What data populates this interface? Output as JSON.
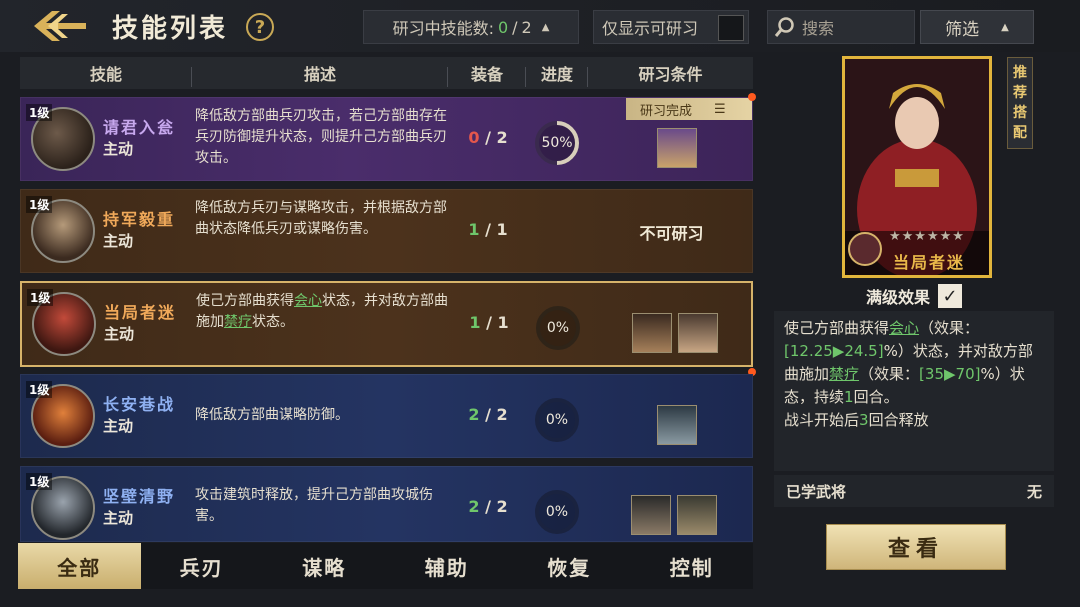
{
  "header": {
    "title": "技能列表",
    "help": "?",
    "research_label": "研习中技能数:",
    "research_current": "0",
    "research_sep": "/",
    "research_max": "2",
    "only_show_label": "仅显示可研习",
    "search_placeholder": "搜索",
    "filter_label": "筛选"
  },
  "columns": {
    "skill": "技能",
    "desc": "描述",
    "equip": "装备",
    "progress": "进度",
    "condition": "研习条件"
  },
  "skills": [
    {
      "level": "1级",
      "name": "请君入瓮",
      "type": "主动",
      "desc": "降低敌方部曲兵刃攻击，若己方部曲存在兵刃防御提升状态，则提升己方部曲兵刃攻击。",
      "equip_cur": "0",
      "equip_max": "2",
      "progress": "50%",
      "progress_value": 0.5,
      "badge": "研习完成"
    },
    {
      "level": "1级",
      "name": "持军毅重",
      "type": "主动",
      "desc": "降低敌方兵刃与谋略攻击，并根据敌方部曲状态降低兵刃或谋略伤害。",
      "equip_cur": "1",
      "equip_max": "1",
      "condition_text": "不可研习"
    },
    {
      "level": "1级",
      "name": "当局者迷",
      "type": "主动",
      "desc_pre": "使己方部曲获得",
      "desc_kw1": "会心",
      "desc_mid": "状态，并对敌方部曲施加",
      "desc_kw2": "禁疗",
      "desc_post": "状态。",
      "equip_cur": "1",
      "equip_max": "1",
      "progress": "0%",
      "progress_value": 0
    },
    {
      "level": "1级",
      "name": "长安巷战",
      "type": "主动",
      "desc": "降低敌方部曲谋略防御。",
      "equip_cur": "2",
      "equip_max": "2",
      "progress": "0%",
      "progress_value": 0
    },
    {
      "level": "1级",
      "name": "坚壁清野",
      "type": "主动",
      "desc": "攻击建筑时释放，提升己方部曲攻城伤害。",
      "equip_cur": "2",
      "equip_max": "2",
      "progress": "0%",
      "progress_value": 0
    }
  ],
  "tabs": [
    "全部",
    "兵刃",
    "谋略",
    "辅助",
    "恢复",
    "控制"
  ],
  "side": {
    "recommend": [
      "推",
      "荐",
      "搭",
      "配"
    ],
    "card_name": "当局者迷",
    "stars": "★★★★★★",
    "max_effect_label": "满级效果",
    "check": "✓",
    "effect": {
      "p1": "使己方部曲获得",
      "kw1": "会心",
      "p2": "（效果：",
      "v1": "[12.25▶24.5]",
      "p3": "%）状态，并对敌方部曲施加",
      "kw2": "禁疗",
      "p4": "（效果：",
      "v2": "[35▶70]",
      "p5": "%）状态，持续",
      "v3": "1",
      "p6": "回合。",
      "line2a": "战斗开始后",
      "v4": "3",
      "line2b": "回合释放"
    },
    "learned_label": "已学武将",
    "learned_value": "无",
    "view_button": "查看"
  },
  "colors": {
    "accent_gold": "#e2b53c",
    "green": "#6fc66b",
    "red": "#e4574c",
    "purple_row": "#4a2d6b",
    "brown_row": "#4c321c",
    "blue_row": "#243462"
  }
}
